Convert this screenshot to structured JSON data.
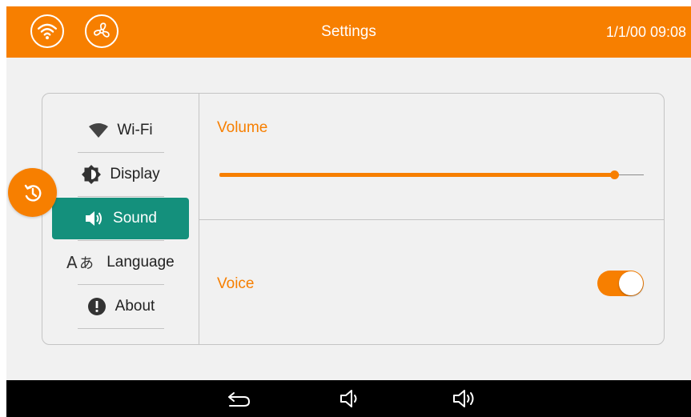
{
  "colors": {
    "accent": "#f77f00",
    "active_nav": "#14907c",
    "background": "#f1f1f1",
    "nav_bar": "#000000"
  },
  "header": {
    "title": "Settings",
    "datetime": "1/1/00 09:08",
    "left_icons": [
      "wifi-icon",
      "fan-icon"
    ]
  },
  "sidebar": {
    "items": [
      {
        "label": "Wi-Fi",
        "icon": "wifi-icon",
        "active": false
      },
      {
        "label": "Display",
        "icon": "brightness-icon",
        "active": false
      },
      {
        "label": "Sound",
        "icon": "speaker-icon",
        "active": true
      },
      {
        "label": "Language",
        "icon": "language-icon",
        "active": false
      },
      {
        "label": "About",
        "icon": "info-icon",
        "active": false
      }
    ]
  },
  "sound": {
    "volume_label": "Volume",
    "volume_level": 0.93,
    "voice_label": "Voice",
    "voice_enabled": true
  },
  "floating_button": {
    "icon": "restore-icon"
  },
  "system_nav": {
    "icons": [
      "back-icon",
      "volume-down-icon",
      "volume-up-icon"
    ]
  }
}
